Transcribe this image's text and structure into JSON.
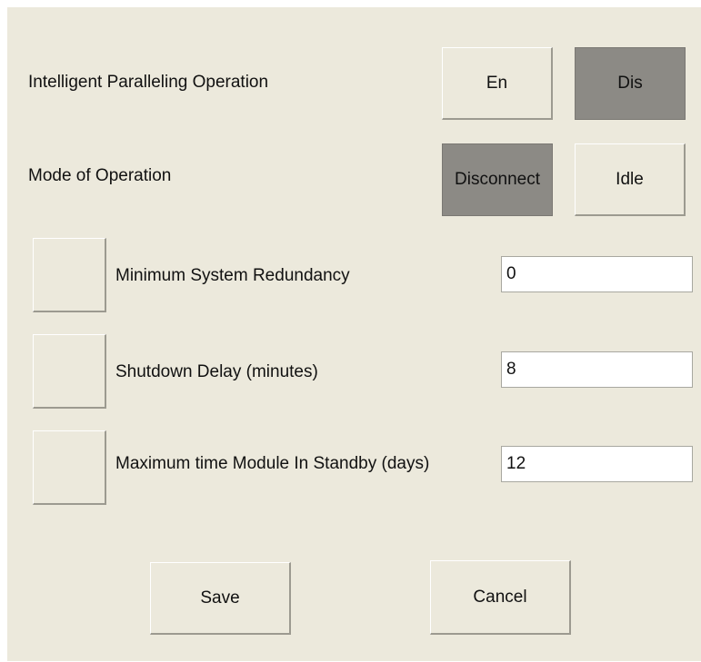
{
  "intelligent_paralleling": {
    "label": "Intelligent Paralleling Operation",
    "enable_label": "En",
    "disable_label": "Dis",
    "selected": "Dis"
  },
  "mode_of_operation": {
    "label": "Mode of Operation",
    "disconnect_label": "Disconnect",
    "idle_label": "Idle",
    "selected": "Disconnect"
  },
  "settings": [
    {
      "label": "Minimum System Redundancy",
      "value": "0",
      "checked": false
    },
    {
      "label": "Shutdown Delay (minutes)",
      "value": "8",
      "checked": false
    },
    {
      "label": "Maximum time Module In Standby (days)",
      "value": "12",
      "checked": false
    }
  ],
  "actions": {
    "save_label": "Save",
    "cancel_label": "Cancel"
  },
  "colors": {
    "panel_background": "#ece9dc",
    "selected_button": "#8c8a85"
  }
}
